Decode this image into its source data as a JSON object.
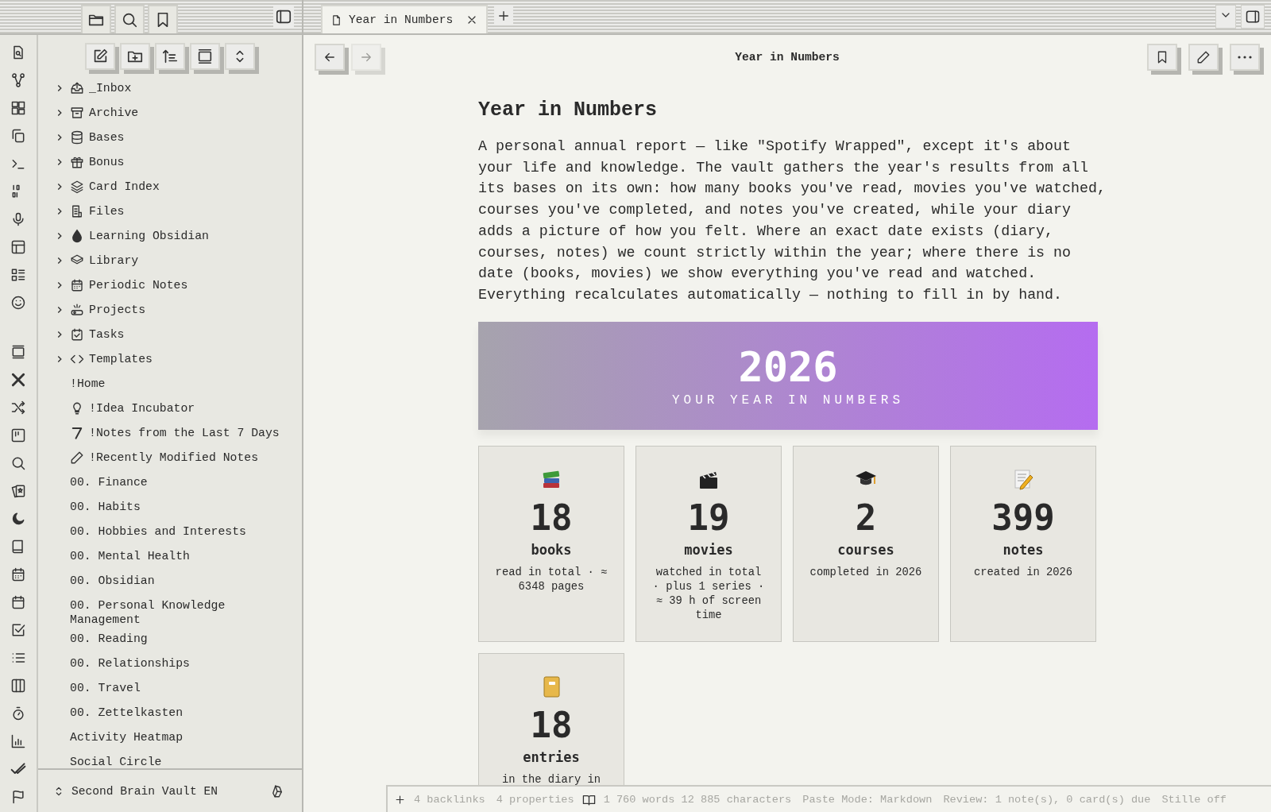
{
  "tabs": [
    {
      "title": "Year in Numbers",
      "selected": true
    }
  ],
  "file_tree": [
    {
      "kind": "folder",
      "name": "_Inbox",
      "expanded": false
    },
    {
      "kind": "folder",
      "name": "Archive",
      "expanded": false
    },
    {
      "kind": "folder",
      "name": "Bases",
      "expanded": false
    },
    {
      "kind": "folder",
      "name": "Bonus",
      "expanded": false
    },
    {
      "kind": "folder",
      "name": "Card Index",
      "expanded": false
    },
    {
      "kind": "folder",
      "name": "Files",
      "expanded": false
    },
    {
      "kind": "folder",
      "name": "Learning Obsidian",
      "expanded": false
    },
    {
      "kind": "folder",
      "name": "Library",
      "expanded": false
    },
    {
      "kind": "folder",
      "name": "Periodic Notes",
      "expanded": false
    },
    {
      "kind": "folder",
      "name": "Projects",
      "expanded": false
    },
    {
      "kind": "folder",
      "name": "Tasks",
      "expanded": false
    },
    {
      "kind": "folder",
      "name": "Templates",
      "expanded": false
    },
    {
      "kind": "file",
      "name": "!Home"
    },
    {
      "kind": "file",
      "name": "!Idea Incubator"
    },
    {
      "kind": "file",
      "name": "!Notes from the Last 7 Days"
    },
    {
      "kind": "file",
      "name": "!Recently Modified Notes"
    },
    {
      "kind": "file",
      "name": "00. Finance"
    },
    {
      "kind": "file",
      "name": "00. Habits"
    },
    {
      "kind": "file",
      "name": "00. Hobbies and Interests"
    },
    {
      "kind": "file",
      "name": "00. Mental Health"
    },
    {
      "kind": "file",
      "name": "00. Obsidian"
    },
    {
      "kind": "file",
      "name": "00. Personal Knowledge Management"
    },
    {
      "kind": "file",
      "name": "00. Reading"
    },
    {
      "kind": "file",
      "name": "00. Relationships"
    },
    {
      "kind": "file",
      "name": "00. Travel"
    },
    {
      "kind": "file",
      "name": "00. Zettelkasten"
    },
    {
      "kind": "file",
      "name": "Activity Heatmap"
    },
    {
      "kind": "file",
      "name": "Social Circle"
    }
  ],
  "vault_name": "Second Brain Vault EN",
  "view_header": {
    "title": "Year in Numbers"
  },
  "note": {
    "title": "Year in Numbers",
    "paragraph": "A personal annual report — like \"Spotify Wrapped\", except it's about your life and knowledge. The vault gathers the year's results from all its bases on its own: how many books you've read, movies you've watched, courses you've completed, and notes you've created, while your diary adds a picture of how you felt. Where an exact date exists (diary, courses, notes) we count strictly within the year; where there is no date (books, movies) we show everything you've read and watched. Everything recalculates automatically — nothing to fill in by hand.",
    "banner": {
      "year": "2026",
      "subtitle": "YOUR YEAR IN NUMBERS"
    },
    "stats": [
      {
        "kind": "books",
        "value": "18",
        "label": "books",
        "description": "read in total · ≈ 6348 pages"
      },
      {
        "kind": "movies",
        "value": "19",
        "label": "movies",
        "description": "watched in total · plus 1 series · ≈ 39 h of screen time"
      },
      {
        "kind": "courses",
        "value": "2",
        "label": "courses",
        "description": "completed in 2026"
      },
      {
        "kind": "notes",
        "value": "399",
        "label": "notes",
        "description": "created in 2026"
      },
      {
        "kind": "diary",
        "value": "18",
        "label": "entries",
        "description": "in the diary in"
      }
    ]
  },
  "status_bar": [
    "4 backlinks",
    "4 properties",
    "1 760 words 12 885 characters",
    "Paste Mode: Markdown",
    "Review: 1 note(s), 0 card(s) due",
    "Stille off"
  ]
}
